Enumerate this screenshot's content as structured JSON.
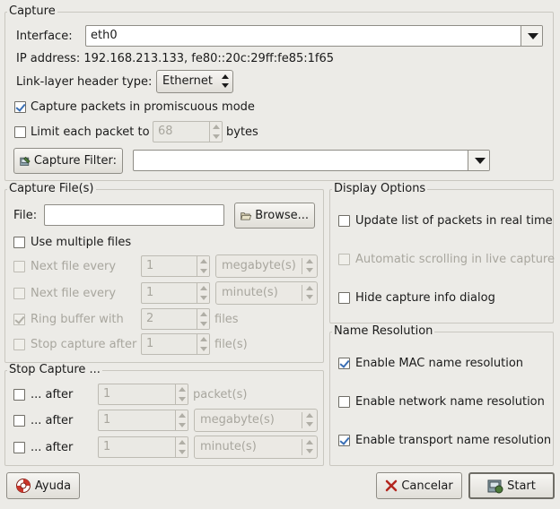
{
  "capture": {
    "title": "Capture",
    "interface_label": "Interface:",
    "interface_value": "eth0",
    "ip_label": "IP address: 192.168.213.133, fe80::20c:29ff:fe85:1f65",
    "link_layer_label": "Link-layer header type:",
    "link_layer_value": "Ethernet",
    "promiscuous_label": "Capture packets in promiscuous mode",
    "promiscuous_checked": true,
    "limit_label": "Limit each packet to",
    "limit_value": "68",
    "limit_unit": "bytes",
    "limit_checked": false,
    "filter_button": "Capture Filter:",
    "filter_value": ""
  },
  "capture_files": {
    "title": "Capture File(s)",
    "file_label": "File:",
    "file_value": "",
    "browse_button": "Browse...",
    "multiple_files_label": "Use multiple files",
    "multiple_files_checked": false,
    "rows": [
      {
        "label": "Next file every",
        "value": "1",
        "unit": "megabyte(s)",
        "checked": false
      },
      {
        "label": "Next file every",
        "value": "1",
        "unit": "minute(s)",
        "checked": false
      },
      {
        "label": "Ring buffer with",
        "value": "2",
        "unit": "files",
        "checked": true
      },
      {
        "label": "Stop capture after",
        "value": "1",
        "unit": "file(s)",
        "checked": false
      }
    ]
  },
  "display_options": {
    "title": "Display Options",
    "update_label": "Update list of packets in real time",
    "update_checked": false,
    "autoscroll_label": "Automatic scrolling in live capture",
    "autoscroll_checked": false,
    "hide_info_label": "Hide capture info dialog",
    "hide_info_checked": false
  },
  "stop_capture": {
    "title": "Stop Capture ...",
    "rows": [
      {
        "label": "... after",
        "value": "1",
        "unit": "packet(s)",
        "checked": false
      },
      {
        "label": "... after",
        "value": "1",
        "unit": "megabyte(s)",
        "checked": false
      },
      {
        "label": "... after",
        "value": "1",
        "unit": "minute(s)",
        "checked": false
      }
    ]
  },
  "name_resolution": {
    "title": "Name Resolution",
    "mac_label": "Enable MAC name resolution",
    "mac_checked": true,
    "network_label": "Enable network name resolution",
    "network_checked": false,
    "transport_label": "Enable transport name resolution",
    "transport_checked": true
  },
  "buttons": {
    "help": "Ayuda",
    "cancel": "Cancelar",
    "start": "Start"
  }
}
